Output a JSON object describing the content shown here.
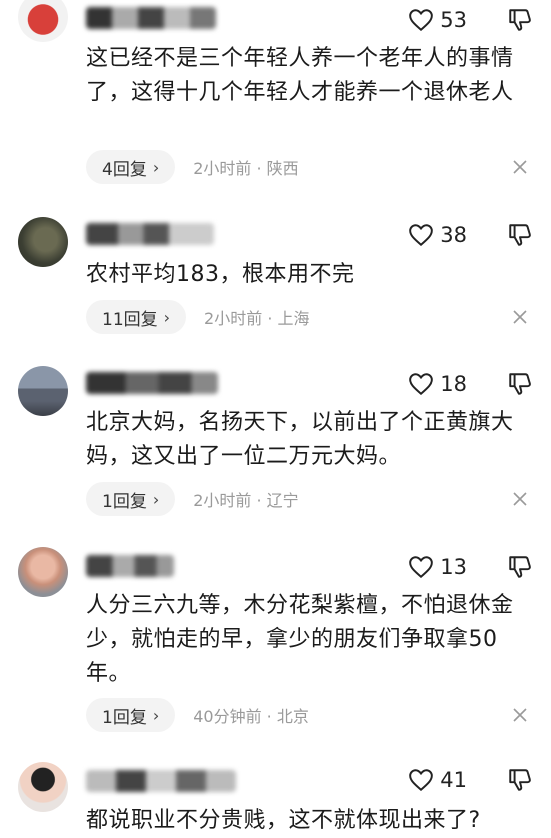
{
  "comments": [
    {
      "likes": "53",
      "text": "这已经不是三个年轻人养一个老年人的事情了，这得十几个年轻人才能养一个退休老人",
      "replies": "4回复",
      "time": "2小时前 · 陕西"
    },
    {
      "likes": "38",
      "text": "农村平均183，根本用不完",
      "replies": "11回复",
      "time": "2小时前 · 上海"
    },
    {
      "likes": "18",
      "text": "北京大妈，名扬天下，以前出了个正黄旗大妈，这又出了一位二万元大妈。",
      "replies": "1回复",
      "time": "2小时前 · 辽宁"
    },
    {
      "likes": "13",
      "text": "人分三六九等，木分花梨紫檀，不怕退休金少，就怕走的早，拿少的朋友们争取拿50年。",
      "replies": "1回复",
      "time": "40分钟前 · 北京"
    },
    {
      "likes": "41",
      "text": "都说职业不分贵贱，这不就体现出来了?"
    }
  ],
  "icons": {
    "like": "heart-outline",
    "dislike": "thumbs-down-outline",
    "dismiss": "close-x",
    "reply_chevron": "chevron-right"
  },
  "colors": {
    "meta_text": "#9a9a9a",
    "reply_pill": "#f3f3f3"
  }
}
